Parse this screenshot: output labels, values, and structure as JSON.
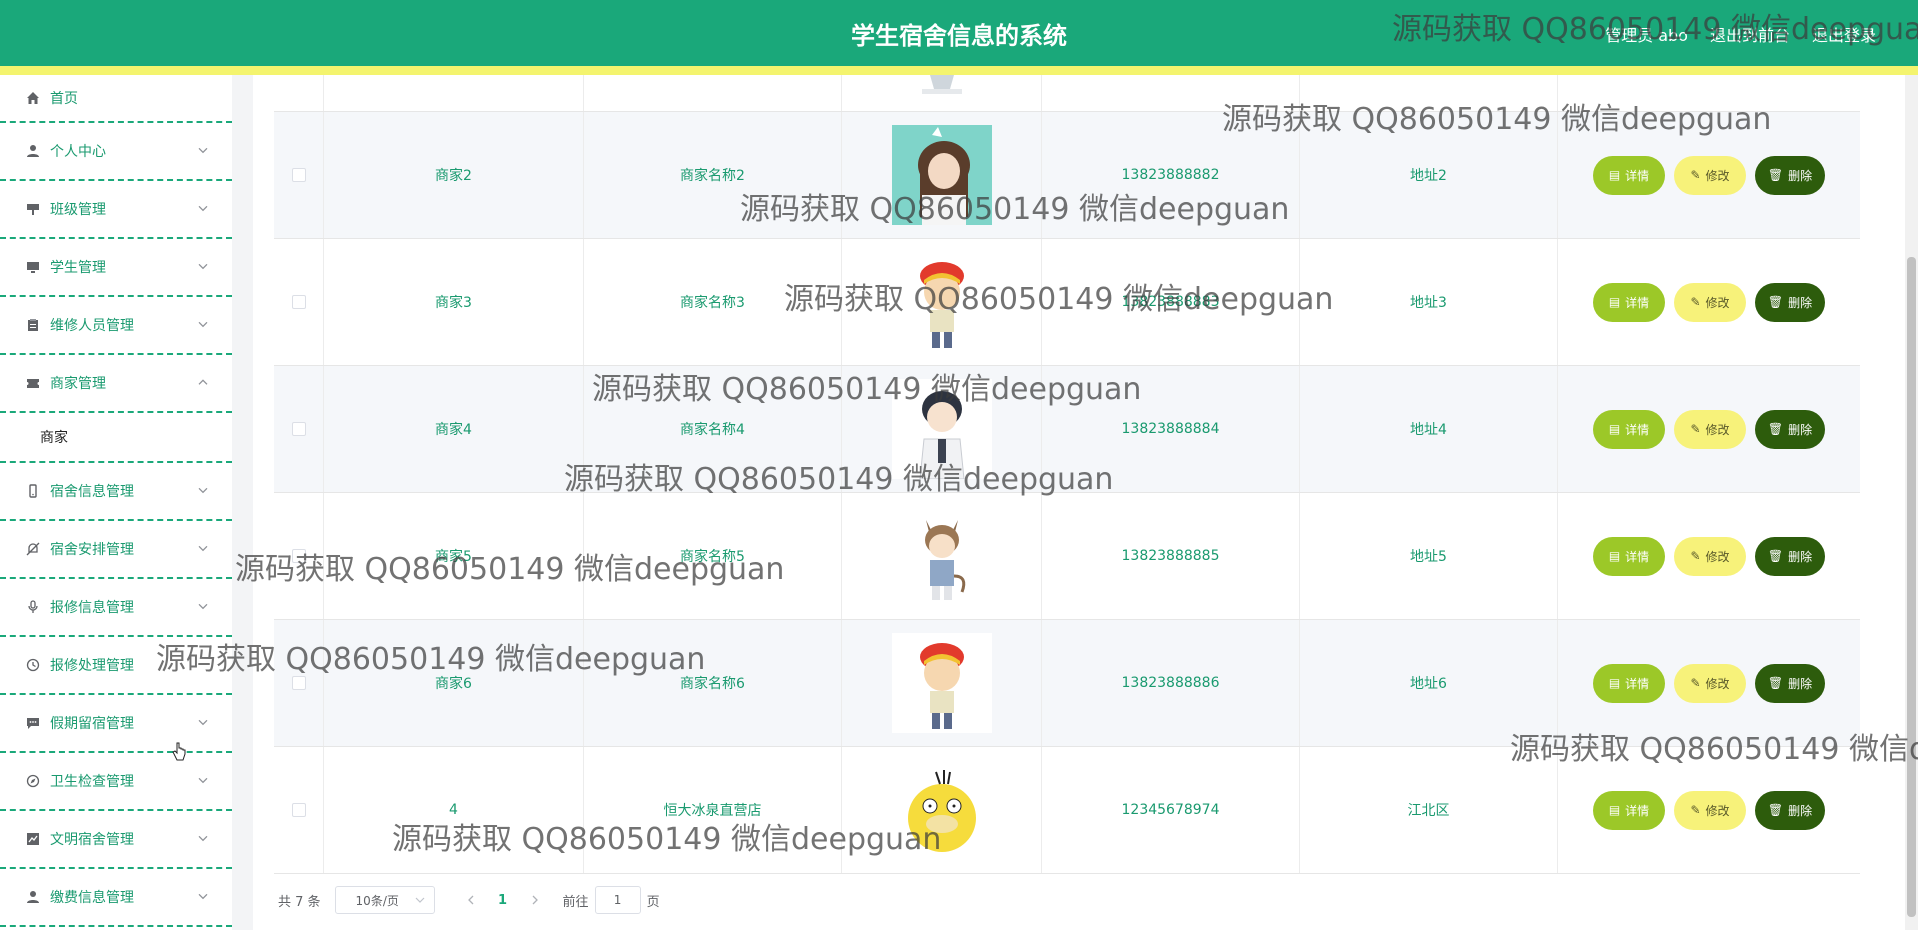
{
  "header": {
    "title": "学生宿舍信息的系统",
    "user_label": "管理员 abo",
    "exit_to_home": "退出到前台",
    "logout": "退出登录"
  },
  "sidebar": {
    "items": [
      {
        "label": "首页",
        "icon": "home-icon",
        "expanded": false,
        "has_chevron": false
      },
      {
        "label": "个人中心",
        "icon": "user-icon",
        "has_chevron": true
      },
      {
        "label": "班级管理",
        "icon": "flag-icon",
        "has_chevron": true
      },
      {
        "label": "学生管理",
        "icon": "monitor-icon",
        "has_chevron": true
      },
      {
        "label": "维修人员管理",
        "icon": "clipboard-icon",
        "has_chevron": true
      },
      {
        "label": "商家管理",
        "icon": "ticket-icon",
        "has_chevron": true,
        "expanded": true,
        "children": [
          "商家"
        ]
      },
      {
        "label": "宿舍信息管理",
        "icon": "phone-icon",
        "has_chevron": true
      },
      {
        "label": "宿舍安排管理",
        "icon": "bell-off-icon",
        "has_chevron": true
      },
      {
        "label": "报修信息管理",
        "icon": "microphone-icon",
        "has_chevron": true
      },
      {
        "label": "报修处理管理",
        "icon": "clock-icon",
        "has_chevron": true
      },
      {
        "label": "假期留宿管理",
        "icon": "chat-icon",
        "has_chevron": true
      },
      {
        "label": "卫生检查管理",
        "icon": "compass-icon",
        "has_chevron": true
      },
      {
        "label": "文明宿舍管理",
        "icon": "chart-icon",
        "has_chevron": true
      },
      {
        "label": "缴费信息管理",
        "icon": "user-icon",
        "has_chevron": true
      }
    ]
  },
  "table": {
    "buttons": {
      "detail": "详情",
      "edit": "修改",
      "delete": "删除"
    },
    "rows": [
      {
        "account": "商家2",
        "name": "商家名称2",
        "avatar": "girl-avatar",
        "phone": "13823888882",
        "address": "地址2"
      },
      {
        "account": "商家3",
        "name": "商家名称3",
        "avatar": "boy-red-cap-avatar",
        "phone": "13823888883",
        "address": "地址3"
      },
      {
        "account": "商家4",
        "name": "商家名称4",
        "avatar": "boy-white-coat-avatar",
        "phone": "13823888884",
        "address": "地址4"
      },
      {
        "account": "商家5",
        "name": "商家名称5",
        "avatar": "cat-boy-avatar",
        "phone": "13823888885",
        "address": "地址5"
      },
      {
        "account": "商家6",
        "name": "商家名称6",
        "avatar": "boy-red-cap-avatar",
        "phone": "13823888886",
        "address": "地址6"
      },
      {
        "account": "4",
        "name": "恒大冰泉直营店",
        "avatar": "psyduck-avatar",
        "phone": "12345678974",
        "address": "江北区"
      }
    ]
  },
  "pagination": {
    "total": "共 7 条",
    "page_size": "10条/页",
    "current_page": "1",
    "goto_label": "前往",
    "goto_value": "1",
    "page_suffix": "页"
  },
  "watermark_text": "源码获取 QQ86050149 微信deepguan",
  "colors": {
    "primary": "#1aa87a",
    "strip": "#f4f46e",
    "detail": "#9cc828",
    "edit": "#f7f27a",
    "delete": "#2d5c0c"
  }
}
